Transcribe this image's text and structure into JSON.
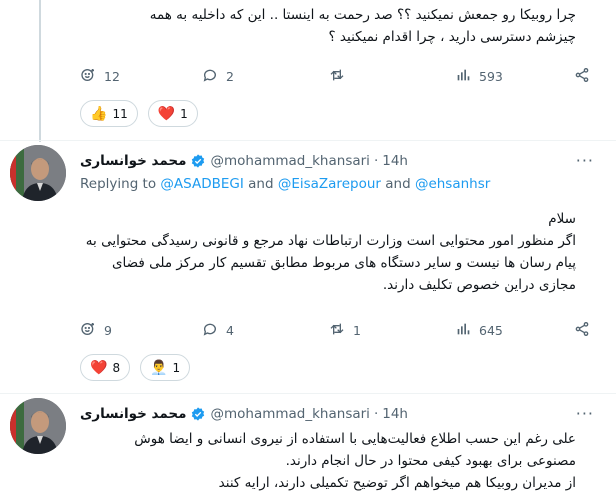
{
  "top_tweet": {
    "text_line1": "چرا روبیکا رو جمعش نمیکنید ؟؟ صد رحمت به اینستا .. این که داخلیه به همه",
    "text_line2": "چیزشم دسترسی دارید ، چرا اقدام نمیکنید ؟",
    "actions": {
      "replies": "12",
      "comments": "2",
      "retweets": "",
      "views": "593"
    },
    "reactions": [
      {
        "emoji": "👍",
        "count": "11"
      },
      {
        "emoji": "❤️",
        "count": "1"
      }
    ]
  },
  "tweet1": {
    "author_name": "محمد خوانساری",
    "handle": "@mohammad_khansari",
    "separator": "·",
    "time": "14h",
    "replying_prefix": "Replying to",
    "mention1": "@ASADBEGI",
    "and1": "and",
    "mention2": "@EisaZarepour",
    "and2": "and",
    "mention3": "@ehsanhsr",
    "lines": [
      "سلام",
      "اگر منظور امور محتوایی است وزارت ارتباطات نهاد مرجع و قانونی رسیدگی محتوایی به",
      "پیام رسان ها نیست و سایر دستگاه های مربوط مطابق تقسیم کار مرکز ملی فضای",
      "مجازی  دراین خصوص تکلیف دارند."
    ],
    "actions": {
      "replies": "9",
      "comments": "4",
      "retweets": "1",
      "views": "645"
    },
    "reactions": [
      {
        "emoji": "❤️",
        "count": "8"
      },
      {
        "emoji": "👨‍💼",
        "count": "1"
      }
    ]
  },
  "tweet2": {
    "author_name": "محمد خوانساری",
    "handle": "@mohammad_khansari",
    "separator": "·",
    "time": "14h",
    "lines": [
      "علی رغم این حسب اطلاع فعالیت‌هایی با استفاده از نیروی انسانی و ایضا هوش",
      "مصنوعی برای بهبود کیفی محتوا در حال انجام دارند.",
      "از مدیران روبیکا هم میخواهم  اگر توضیح تکمیلی دارند، ارایه کنند"
    ]
  },
  "more_label": "···",
  "colors": {
    "accent": "#1d9bf0",
    "muted": "#536471",
    "border": "#cfd9de"
  },
  "icons": [
    "reply-emoji-icon",
    "comment-icon",
    "retweet-icon",
    "views-icon",
    "share-icon",
    "verified-badge-icon",
    "more-icon"
  ]
}
